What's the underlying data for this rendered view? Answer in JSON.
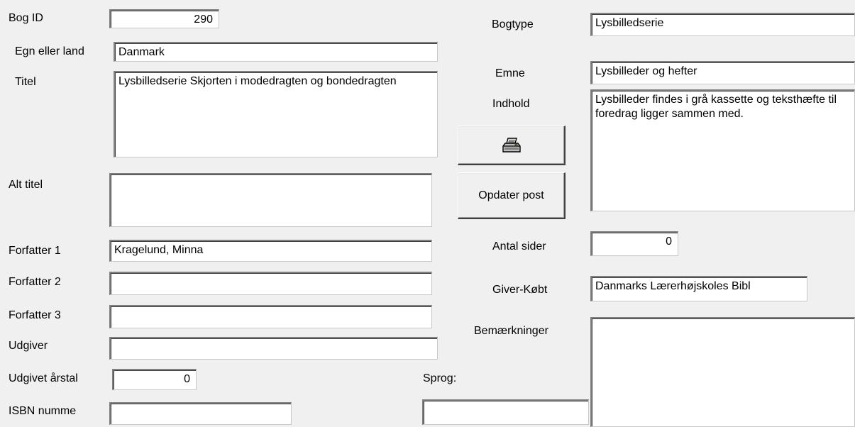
{
  "labels": {
    "bog_id": "Bog ID",
    "egn": "Egn eller land",
    "titel": "Titel",
    "alt_titel": "Alt titel",
    "forfatter1": "Forfatter 1",
    "forfatter2": "Forfatter 2",
    "forfatter3": "Forfatter 3",
    "udgiver": "Udgiver",
    "udgivet_aarstal": "Udgivet årstal",
    "isbn": "ISBN numme",
    "sprog": "Sprog:",
    "bogtype": "Bogtype",
    "emne": "Emne",
    "indhold": "Indhold",
    "antal_sider": "Antal sider",
    "giver_koebt": "Giver-Købt",
    "bemaerkninger": "Bemærkninger"
  },
  "values": {
    "bog_id": "290",
    "egn": "Danmark",
    "titel": "Lysbilledserie Skjorten i modedragten og bondedragten",
    "alt_titel": "",
    "forfatter1": "Kragelund, Minna",
    "forfatter2": "",
    "forfatter3": "",
    "udgiver": "",
    "udgivet_aarstal": "0",
    "isbn": "",
    "sprog": "",
    "bogtype": "Lysbilledserie",
    "emne": "Lysbilleder og hefter",
    "indhold": "Lysbilleder findes i grå kassette og teksthæfte til foredrag ligger sammen med.",
    "antal_sider": "0",
    "giver_koebt": "Danmarks Lærerhøjskoles Bibl",
    "bemaerkninger": ""
  },
  "buttons": {
    "print_icon": "printer-icon",
    "opdater_post": "Opdater post"
  }
}
